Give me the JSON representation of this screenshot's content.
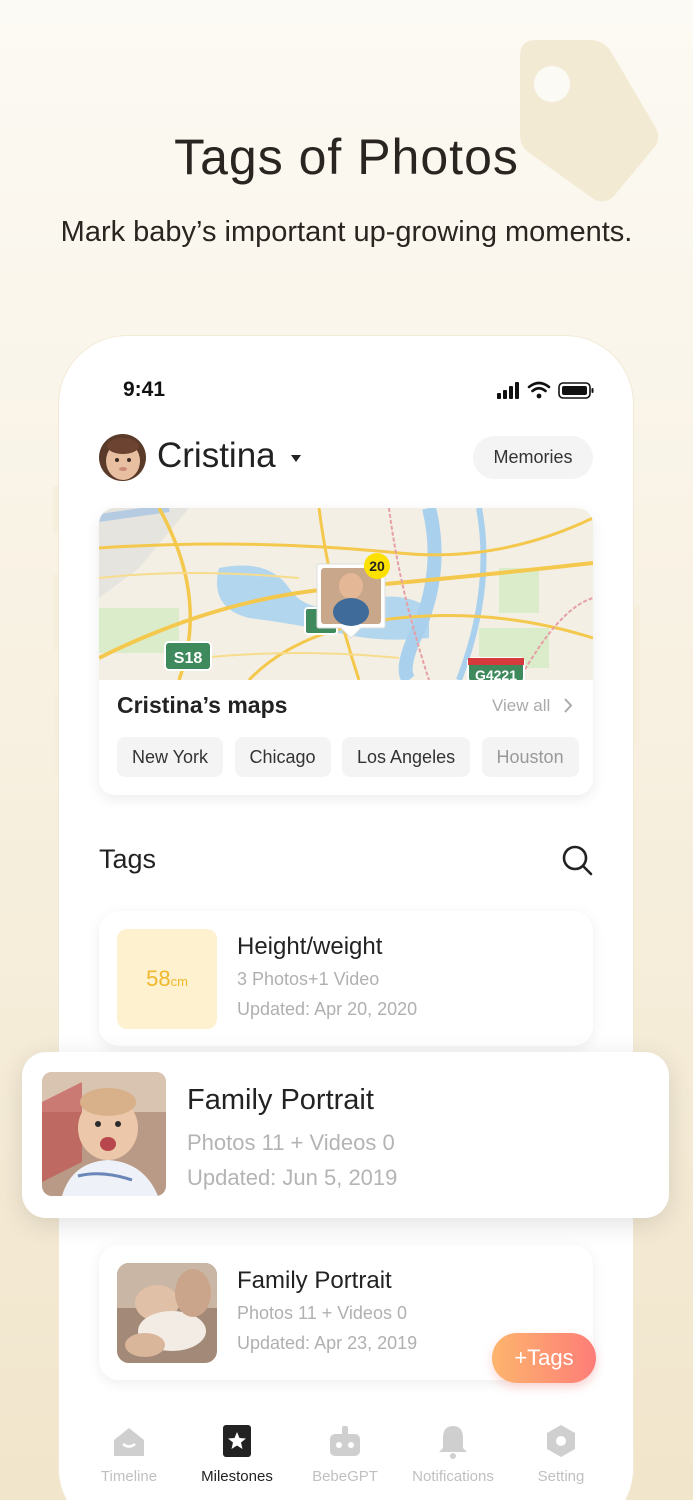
{
  "promo": {
    "title": "Tags of Photos",
    "subtitle": "Mark baby’s important up-growing moments."
  },
  "status_bar": {
    "time": "9:41"
  },
  "header": {
    "user_name": "Cristina",
    "memories_label": "Memories"
  },
  "map_card": {
    "title": "Cristina’s maps",
    "view_all": "View all",
    "marker_count": "20",
    "road_signs": [
      "S18",
      "G4221"
    ],
    "cities": [
      "New York",
      "Chicago",
      "Los Angeles",
      "Houston"
    ]
  },
  "tags_section": {
    "title": "Tags"
  },
  "tags": [
    {
      "thumb_value": "58",
      "thumb_unit": "cm",
      "title": "Height/weight",
      "line1": "3 Photos+1 Video",
      "line2": "Updated: Apr 20, 2020"
    },
    {
      "title": "Family Portrait",
      "line1": "Photos 11 + Videos 0",
      "line2": "Updated: Jun 5, 2019"
    },
    {
      "title": "Family Portrait",
      "line1": "Photos 11 + Videos 0",
      "line2": "Updated: Apr 23, 2019"
    }
  ],
  "fab_label": "+Tags",
  "tabbar": [
    {
      "label": "Timeline",
      "icon": "home-icon"
    },
    {
      "label": "Milestones",
      "icon": "star-bookmark-icon"
    },
    {
      "label": "BebeGPT",
      "icon": "robot-icon"
    },
    {
      "label": "Notifications",
      "icon": "bell-icon"
    },
    {
      "label": "Setting",
      "icon": "gear-icon"
    }
  ],
  "active_tab": "Milestones",
  "colors": {
    "accent": "#fd7d78",
    "highlight": "#f0b82a",
    "background": "#f8f1e2"
  }
}
